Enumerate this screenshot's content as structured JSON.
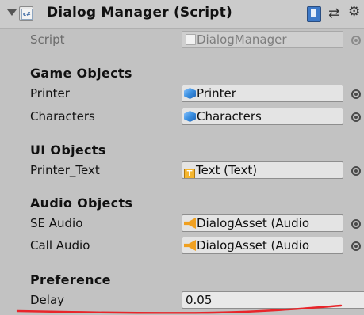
{
  "component": {
    "title": "Dialog Manager (Script)",
    "icon": "cs-script-icon",
    "cs_badge": "c#"
  },
  "script_row": {
    "label": "Script",
    "value": "DialogManager"
  },
  "sections": {
    "game_objects": {
      "header": "Game Objects",
      "printer": {
        "label": "Printer",
        "value": "Printer",
        "icon": "prefab-icon"
      },
      "characters": {
        "label": "Characters",
        "value": "Characters",
        "icon": "prefab-icon"
      }
    },
    "ui_objects": {
      "header": "UI Objects",
      "printer_text": {
        "label": "Printer_Text",
        "value": "Text (Text)",
        "icon": "text-component-icon"
      }
    },
    "audio_objects": {
      "header": "Audio Objects",
      "se_audio": {
        "label": "SE Audio",
        "value": "DialogAsset (Audio",
        "icon": "audio-source-icon"
      },
      "call_audio": {
        "label": "Call Audio",
        "value": "DialogAsset (Audio",
        "icon": "audio-source-icon"
      }
    },
    "preference": {
      "header": "Preference",
      "delay": {
        "label": "Delay",
        "value": "0.05"
      }
    }
  },
  "colors": {
    "background": "#c2c2c2",
    "field": "#e4e4e4",
    "annotation_red": "#e8252a"
  }
}
